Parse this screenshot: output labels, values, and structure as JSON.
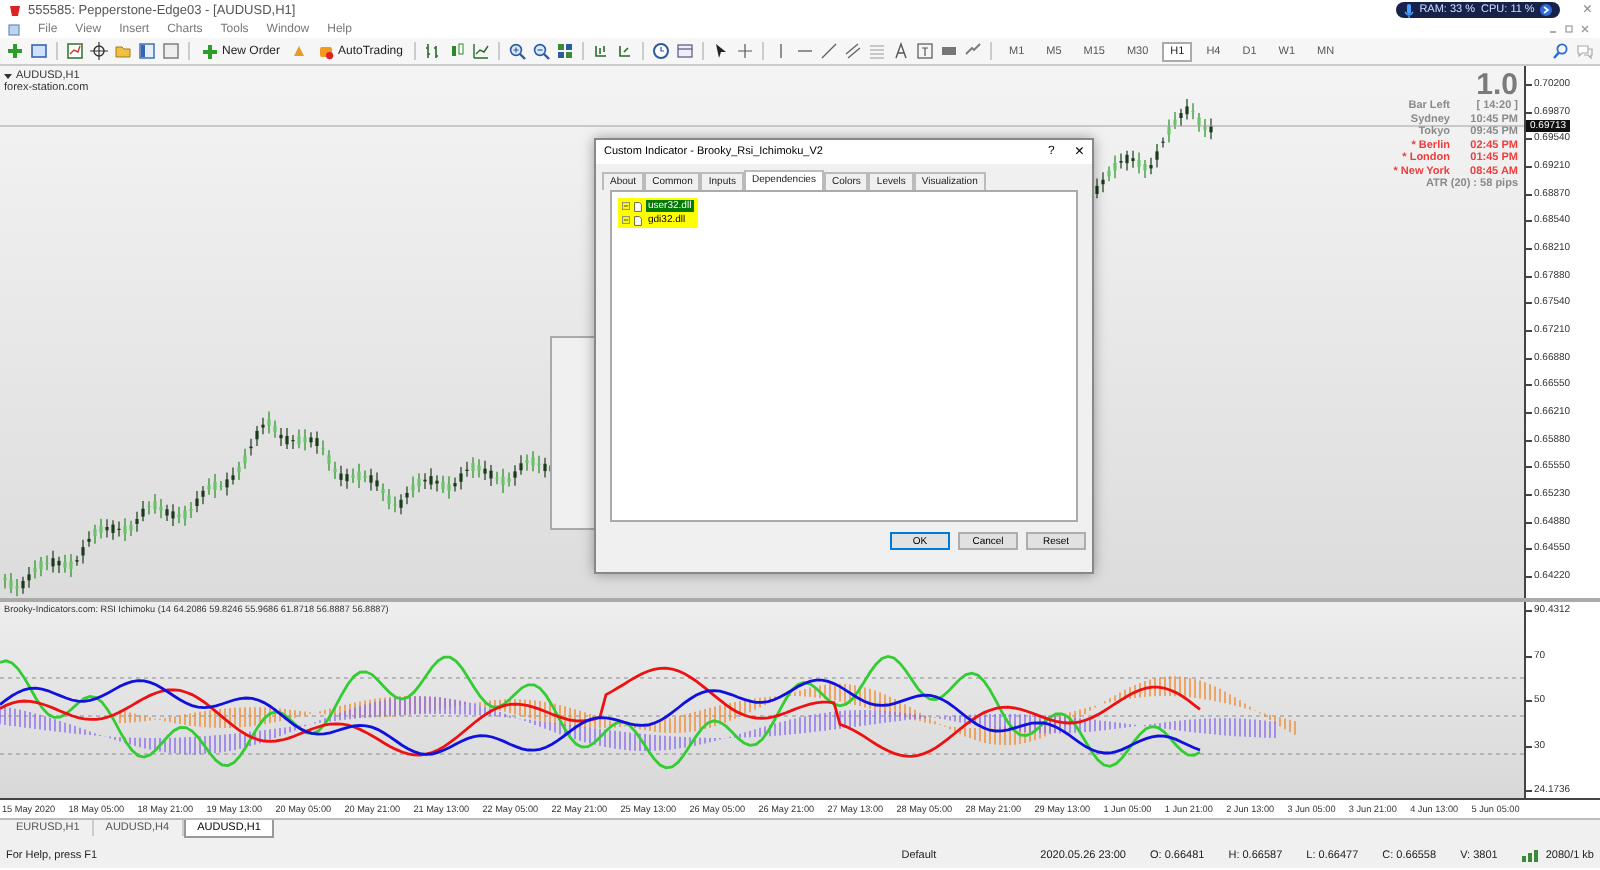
{
  "window": {
    "title": "555585: Pepperstone-Edge03 - [AUDUSD,H1]",
    "close": "×"
  },
  "monitor": {
    "ram": "RAM: 33 %",
    "cpu": "CPU: 11 %"
  },
  "menu": [
    "File",
    "View",
    "Insert",
    "Charts",
    "Tools",
    "Window",
    "Help"
  ],
  "toolbar": {
    "buttons": [
      "New Order",
      "AutoTrading"
    ],
    "timeframes": [
      {
        "label": "M1",
        "selected": false
      },
      {
        "label": "M5",
        "selected": false
      },
      {
        "label": "M15",
        "selected": false
      },
      {
        "label": "M30",
        "selected": false
      },
      {
        "label": "H1",
        "selected": true
      },
      {
        "label": "H4",
        "selected": false
      },
      {
        "label": "D1",
        "selected": false
      },
      {
        "label": "W1",
        "selected": false
      },
      {
        "label": "MN",
        "selected": false
      }
    ]
  },
  "chart": {
    "symbol": "AUDUSD,H1",
    "source": "forex-station.com",
    "big_value": "1.0",
    "info": [
      {
        "label": "Bar Left",
        "value": "[ 14:20 ]",
        "color": "#8a8a8a"
      },
      {
        "label": "Sydney",
        "value": "10:45 PM",
        "color": "#8a8a8a"
      },
      {
        "label": "Tokyo",
        "value": "09:45 PM",
        "color": "#8a8a8a"
      },
      {
        "label": "* Berlin",
        "value": "02:45 PM",
        "color": "#f03c3c"
      },
      {
        "label": "* London",
        "value": "01:45 PM",
        "color": "#f03c3c"
      },
      {
        "label": "* New York",
        "value": "08:45 AM",
        "color": "#f03c3c"
      }
    ],
    "atr": "ATR (20) : 58 pips",
    "current_price": "0.69713",
    "price_scale": [
      "0.70200",
      "0.69870",
      "0.69540",
      "0.69210",
      "0.68870",
      "0.68540",
      "0.68210",
      "0.67880",
      "0.67540",
      "0.67210",
      "0.66880",
      "0.66550",
      "0.66210",
      "0.65880",
      "0.65550",
      "0.65230",
      "0.64880",
      "0.64550",
      "0.64220"
    ]
  },
  "indicator": {
    "label": "Brooky-Indicators.com: RSI Ichimoku (14 64.2086 59.8246 55.9686 61.8718 56.8887 56.8887)",
    "scale": [
      "90.4312",
      "70",
      "50",
      "30",
      "24.1736"
    ]
  },
  "time_axis": [
    "15 May 2020",
    "18 May 05:00",
    "18 May 21:00",
    "19 May 13:00",
    "20 May 05:00",
    "20 May 21:00",
    "21 May 13:00",
    "22 May 05:00",
    "22 May 21:00",
    "25 May 13:00",
    "26 May 05:00",
    "26 May 21:00",
    "27 May 13:00",
    "28 May 05:00",
    "28 May 21:00",
    "29 May 13:00",
    "1 Jun 05:00",
    "1 Jun 21:00",
    "2 Jun 13:00",
    "3 Jun 05:00",
    "3 Jun 21:00",
    "4 Jun 13:00",
    "5 Jun 05:00"
  ],
  "chart_tabs": [
    {
      "label": "EURUSD,H1",
      "selected": false
    },
    {
      "label": "AUDUSD,H4",
      "selected": false
    },
    {
      "label": "AUDUSD,H1",
      "selected": true
    }
  ],
  "status_bar": {
    "help": "For Help, press F1",
    "profile": "Default",
    "fields": [
      "2020.05.26 23:00",
      "O: 0.66481",
      "H: 0.66587",
      "L: 0.66477",
      "C: 0.66558",
      "V: 3801"
    ],
    "traffic": "2080/1 kb"
  },
  "dialog": {
    "title": "Custom Indicator - Brooky_Rsi_Ichimoku_V2",
    "help": "?",
    "close": "×",
    "tabs": [
      {
        "label": "About",
        "selected": false
      },
      {
        "label": "Common",
        "selected": false
      },
      {
        "label": "Inputs",
        "selected": false
      },
      {
        "label": "Dependencies",
        "selected": true
      },
      {
        "label": "Colors",
        "selected": false
      },
      {
        "label": "Levels",
        "selected": false
      },
      {
        "label": "Visualization",
        "selected": false
      }
    ],
    "items": [
      {
        "label": "user32.dll",
        "selected": true
      },
      {
        "label": "gdi32.dll",
        "selected": false
      }
    ],
    "buttons": [
      "OK",
      "Cancel",
      "Reset"
    ]
  }
}
